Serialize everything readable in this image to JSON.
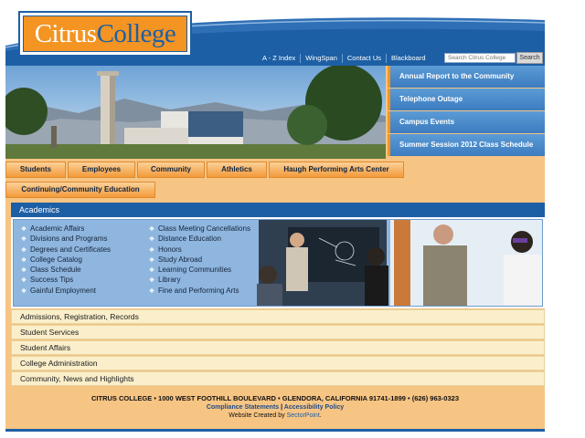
{
  "header": {
    "logo": {
      "part1": "Citrus",
      "part2": "College"
    },
    "toplinks": [
      "A - Z Index",
      "WingSpan",
      "Contact Us",
      "Blackboard"
    ],
    "search": {
      "placeholder": "Search Citrus College",
      "button": "Search"
    }
  },
  "sidebar_links": [
    "Annual Report to the Community",
    "Telephone Outage",
    "Campus Events",
    "Summer Session 2012 Class Schedule"
  ],
  "nav_main": [
    "Students",
    "Employees",
    "Community",
    "Athletics",
    "Haugh Performing Arts Center"
  ],
  "nav_secondary": [
    "Continuing/Community Education"
  ],
  "academics": {
    "title": "Academics",
    "col1": [
      "Academic Affairs",
      "Divisions and Programs",
      "Degrees and Certificates",
      "College Catalog",
      "Class Schedule",
      "Success Tips",
      "Gainful Employment"
    ],
    "col2": [
      "Class Meeting Cancellations",
      "Distance Education",
      "Honors",
      "Study Abroad",
      "Learning Communities",
      "Library",
      "Fine and Performing Arts"
    ]
  },
  "accordion": [
    "Admissions, Registration, Records",
    "Student Services",
    "Student Affairs",
    "College Administration",
    "Community, News and Highlights"
  ],
  "footer": {
    "address": "CITRUS COLLEGE • 1000 WEST FOOTHILL BOULEVARD • GLENDORA, CALIFORNIA 91741-1899 • (626) 963-0323",
    "compliance": "Compliance Statements",
    "separator": "|",
    "accessibility": "Accessibility Policy",
    "credit_prefix": "Website Created by ",
    "credit_link": "SectorPoint",
    "credit_suffix": "."
  },
  "colors": {
    "blue": "#1d5fa5",
    "orange": "#f39423",
    "page_bg": "#f6c483",
    "accordion_bg": "#fbefcb"
  }
}
